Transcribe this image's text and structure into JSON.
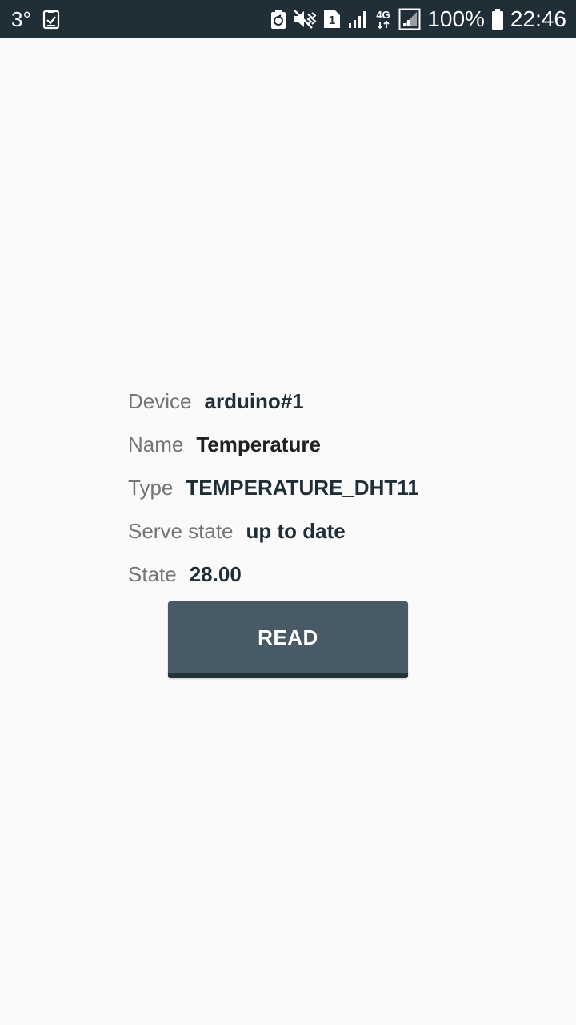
{
  "status_bar": {
    "temperature": "3°",
    "battery_percent": "100%",
    "time": "22:46",
    "sim_slot": "1",
    "network_type": "4G",
    "icons": [
      "clipboard-check-icon",
      "battery-saver-icon",
      "mute-vibrate-icon",
      "sim-icon",
      "signal-icon",
      "network-4g-icon",
      "signal-box-icon",
      "battery-icon"
    ]
  },
  "device_info": {
    "device_label": "Device",
    "device_value": "arduino#1",
    "name_label": "Name",
    "name_value": "Temperature",
    "type_label": "Type",
    "type_value": "TEMPERATURE_DHT11",
    "serve_state_label": "Serve state",
    "serve_state_value": "up to date",
    "state_label": "State",
    "state_value": "28.00"
  },
  "actions": {
    "read_label": "READ"
  },
  "colors": {
    "status_bar_bg": "#1f2e37",
    "background": "#fafafa",
    "button_bg": "#475a65",
    "label_color": "#757575",
    "value_color": "#1f2e37"
  }
}
